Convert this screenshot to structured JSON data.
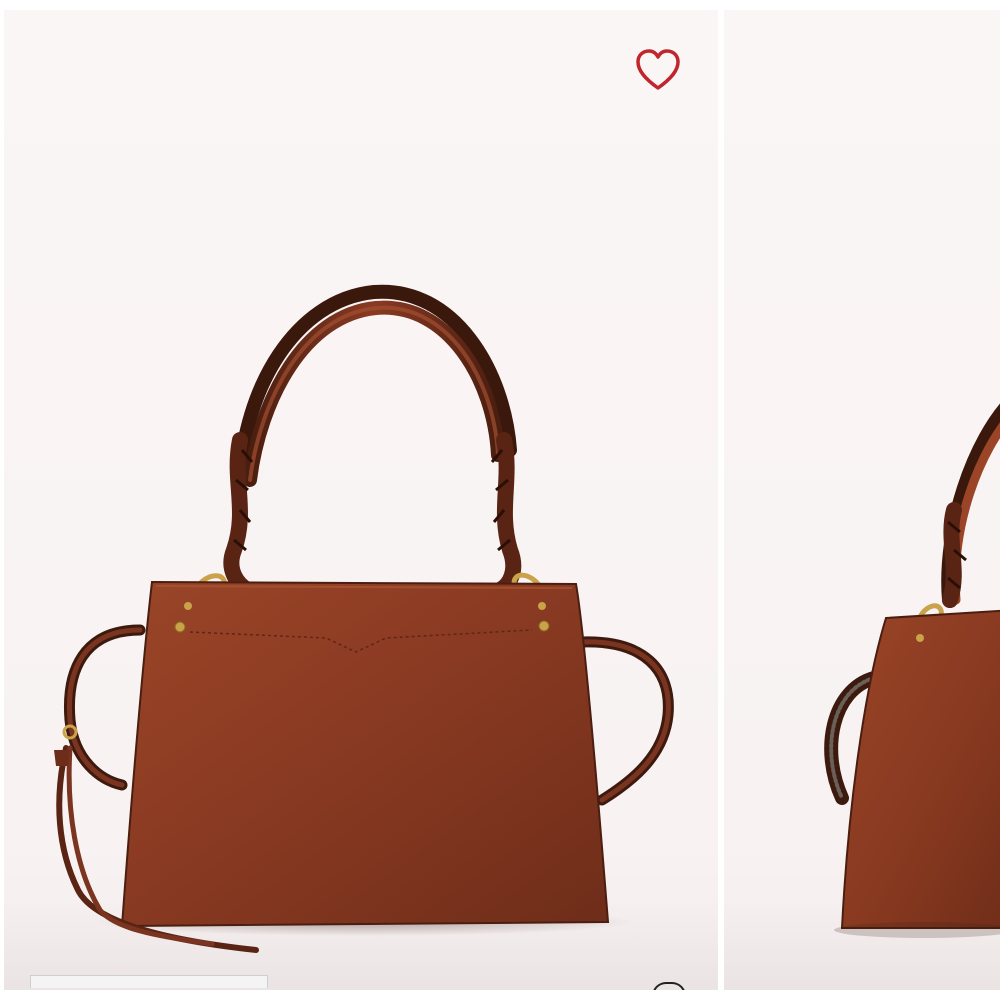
{
  "gallery": {
    "main_image_icon": "handbag-photo",
    "next_image_icon": "handbag-photo-side"
  },
  "favorite": {
    "icon": "heart-outline-icon",
    "color": "#c0262d"
  },
  "colors": {
    "background": "#f8f2f2",
    "leather": "#8a3a22",
    "leather_dark": "#5a2414",
    "hardware": "#c9a24a"
  }
}
